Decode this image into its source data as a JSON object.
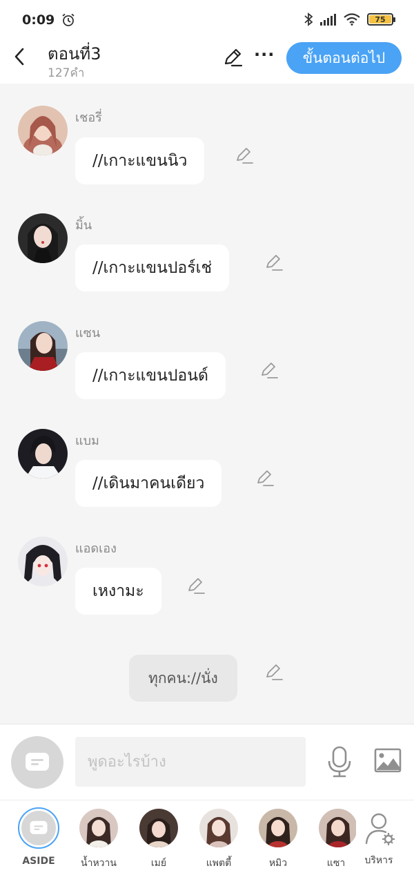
{
  "status_bar": {
    "time": "0:09",
    "battery": "75"
  },
  "header": {
    "title": "ตอนที่3",
    "word_count": "127คำ",
    "next_label": "ขั้นตอนต่อไป",
    "more_label": "···"
  },
  "messages": [
    {
      "sender": "เชอรี่",
      "text": "//เกาะแขนนิว"
    },
    {
      "sender": "มิ้น",
      "text": "//เกาะแขนปอร์เช่"
    },
    {
      "sender": "แซน",
      "text": "//เกาะแขนปอนด์"
    },
    {
      "sender": "แบม",
      "text": "//เดินมาคนเดียว"
    },
    {
      "sender": "แอดเอง",
      "text": "เหงามะ"
    }
  ],
  "narration": {
    "text": "ทุกคน://นั่ง"
  },
  "input": {
    "placeholder": "พูดอะไรบ้าง"
  },
  "characters": [
    {
      "name": "ASIDE"
    },
    {
      "name": "น้ำหวาน"
    },
    {
      "name": "เมย์"
    },
    {
      "name": "แพตตี้"
    },
    {
      "name": "หมิว"
    },
    {
      "name": "แซา"
    },
    {
      "name": "บริหาร"
    }
  ],
  "colors": {
    "accent": "#4aa3f5",
    "background": "#f5f5f5",
    "bubble": "#ffffff",
    "narration_bubble": "#e8e8e8"
  }
}
